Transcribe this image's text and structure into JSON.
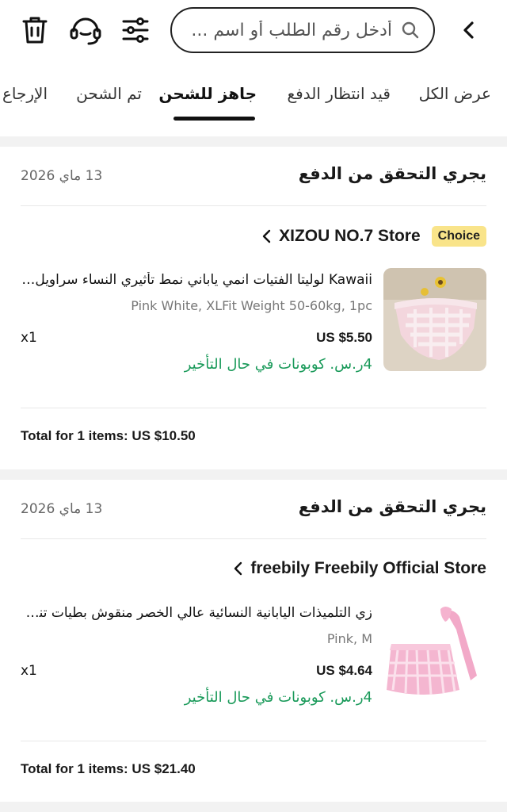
{
  "header": {
    "search_placeholder": "أدخل رقم الطلب أو اسم ...",
    "icons": [
      "trash-icon",
      "support-headset-icon",
      "filter-sliders-icon",
      "search-icon",
      "chevron-left-icon"
    ]
  },
  "tabs": [
    {
      "label": "عرض الكل"
    },
    {
      "label": "قيد انتظار الدفع"
    },
    {
      "label": "جاهز للشحن"
    },
    {
      "label": "تم الشحن"
    },
    {
      "label": "الإرجاع"
    }
  ],
  "orders": [
    {
      "status": "يجري التحقق من الدفع",
      "date": "13 ماي 2026",
      "badge": "Choice",
      "store": "XIZOU NO.7 Store",
      "item": {
        "title": "Kawaii لوليتا الفتيات انمي ياباني نمط تأثيري النساء سراويل م...",
        "variant": "Pink White, XLFit Weight 50-60kg, 1pc",
        "price": "US $5.50",
        "qty": "x1",
        "coupon": "4ر.س. كوبونات في حال التأخير"
      },
      "total": "Total for 1 items: US $10.50"
    },
    {
      "status": "يجري التحقق من الدفع",
      "date": "13 ماي 2026",
      "store": "freebily Freebily Official Store",
      "item": {
        "title": "زي التلميذات اليابانية النسائية عالي الخصر منقوش بطيات تنور...",
        "variant": "Pink, M",
        "price": "US $4.64",
        "qty": "x1",
        "coupon": "4ر.س. كوبونات في حال التأخير"
      },
      "total": "Total for 1 items: US $21.40"
    }
  ],
  "colors": {
    "accent_green": "#1a9a5a",
    "choice_badge": "#f9e48a",
    "background": "#f2f2f2"
  }
}
